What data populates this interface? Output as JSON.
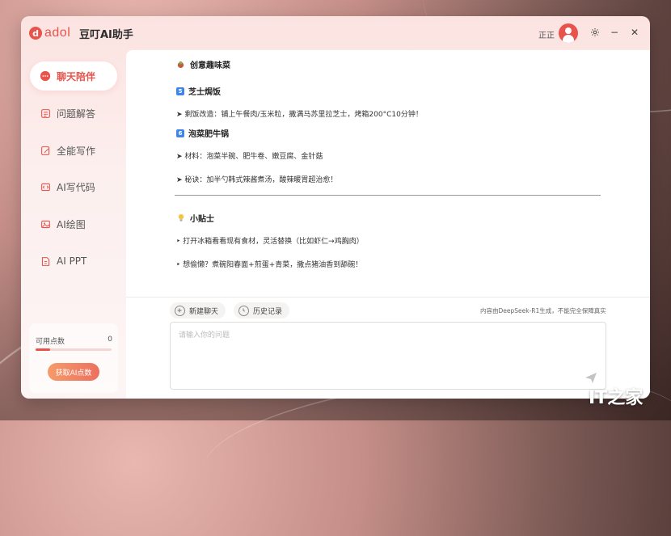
{
  "app": {
    "logo_letter": "d",
    "logo_text": "adol",
    "title": "豆叮AI助手",
    "username": "正正",
    "accent_color": "#e8544c"
  },
  "window_controls": {
    "settings_icon": "gear-icon",
    "minimize": "−",
    "close": "✕"
  },
  "sidebar": {
    "items": [
      {
        "label": "聊天陪伴",
        "icon": "chat-icon",
        "active": true
      },
      {
        "label": "问题解答",
        "icon": "document-list-icon",
        "active": false
      },
      {
        "label": "全能写作",
        "icon": "pen-icon",
        "active": false
      },
      {
        "label": "AI写代码",
        "icon": "code-icon",
        "active": false
      },
      {
        "label": "AI绘图",
        "icon": "image-icon",
        "active": false
      },
      {
        "label": "AI PPT",
        "icon": "ppt-icon",
        "active": false
      }
    ],
    "points": {
      "label": "可用点数",
      "value": "0",
      "button": "获取AI点数"
    }
  },
  "chat": {
    "section_title": "创意趣味菜",
    "item5_badge": "5",
    "item5_title": "芝士焗饭",
    "item5_line": "➤ 剩饭改造：铺上午餐肉/玉米粒，撒满马苏里拉芝士，烤箱200°C10分钟！",
    "item6_badge": "6",
    "item6_title": "泡菜肥牛锅",
    "item6_line1": "➤ 材料：泡菜半碗、肥牛卷、嫩豆腐、金针菇",
    "item6_line2": "➤ 秘诀：加半勺韩式辣酱煮汤，酸辣暖胃超治愈！",
    "tips_title": "小贴士",
    "tip1": "‣ 打开冰箱看看现有食材，灵活替换（比如虾仁→鸡胸肉）",
    "tip2": "‣ 想偷懒？煮碗阳春面+煎蛋+青菜，撒点猪油香到舔碗！"
  },
  "bottom": {
    "new_chat": "新建聊天",
    "history": "历史记录",
    "disclaimer": "内容由DeepSeek-R1生成，不能完全保障真实",
    "input_placeholder": "请输入你的问题"
  },
  "watermark": "IT之家"
}
